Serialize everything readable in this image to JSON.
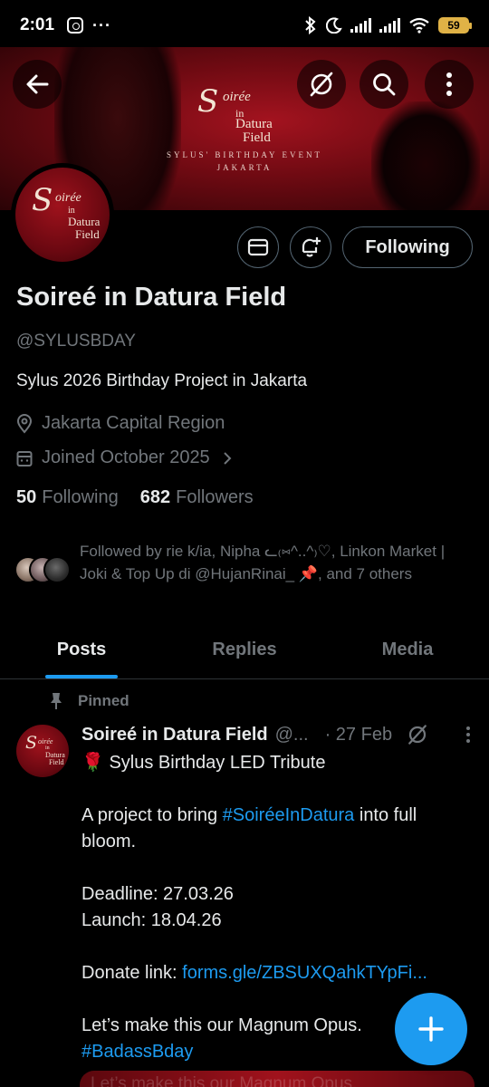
{
  "status_bar": {
    "time": "2:01",
    "dots": "···",
    "battery": "59",
    "icons": [
      "app-notification-icon",
      "bluetooth-icon",
      "moon-icon",
      "signal-icon",
      "signal-icon",
      "wifi-icon",
      "battery-icon"
    ]
  },
  "banner": {
    "logo_script": "S",
    "logo_oiree": "oirée",
    "logo_in": "in",
    "logo_datura": "Datura",
    "logo_field": "Field",
    "subtitle_line1": "SYLUS' BIRTHDAY EVENT",
    "subtitle_line2": "JAKARTA",
    "buttons": [
      "back-arrow-icon",
      "grok-icon",
      "search-icon",
      "more-vertical-icon"
    ]
  },
  "profile": {
    "name": "Soireé in Datura Field",
    "handle": "@SYLUSBDAY",
    "bio": "Sylus 2026 Birthday Project in Jakarta",
    "location": "Jakarta Capital Region",
    "joined": "Joined October 2025",
    "following_count": "50",
    "following_label": "Following",
    "followers_count": "682",
    "followers_label": "Followers",
    "follow_button": "Following",
    "followed_by": "Followed by rie k/ia, Nipha ᓚ₍⑅^..^₎♡, Linkon Market | Joki & Top Up di @HujanRinai_ 📌, and 7 others"
  },
  "tabs": [
    {
      "label": "Posts",
      "active": true
    },
    {
      "label": "Replies",
      "active": false
    },
    {
      "label": "Media",
      "active": false
    }
  ],
  "post": {
    "pinned_label": "Pinned",
    "author": "Soireé in Datura Field",
    "handle": "@...",
    "date": "· 27 Feb",
    "line1": "🌹 Sylus Birthday LED Tribute",
    "line2_pre": "A project to bring ",
    "line2_tag": "#SoiréeInDatura",
    "line2_post": " into full bloom.",
    "deadline": "Deadline: 27.03.26",
    "launch": "Launch: 18.04.26",
    "donate_pre": "Donate link: ",
    "donate_link": "forms.gle/ZBSUXQahkTYpFi...",
    "closing": "Let’s make this our Magnum Opus.",
    "hashtag": "#BadassBday",
    "media_peek_text": "Let’s make this our Magnum Opus."
  },
  "colors": {
    "accent": "#1d9bf0",
    "muted": "#71767b",
    "text": "#e7e9ea",
    "banner_red": "#a3131f",
    "battery": "#e0b246"
  }
}
